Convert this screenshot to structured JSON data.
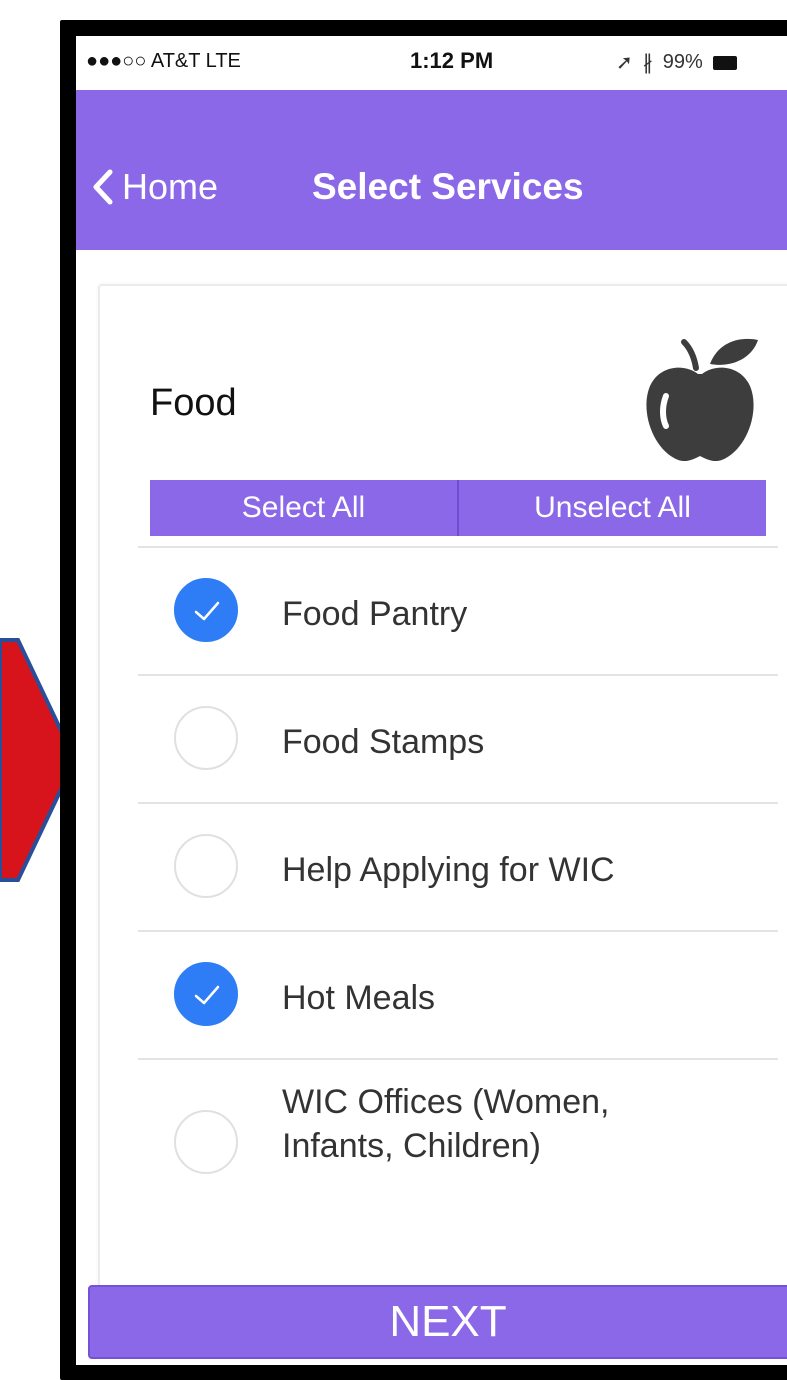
{
  "status_bar": {
    "carrier": "●●●○○ AT&T  LTE",
    "time": "1:12 PM",
    "battery": "99%"
  },
  "nav": {
    "back_label": "Home",
    "title": "Select Services"
  },
  "category": {
    "title": "Food",
    "icon": "apple-icon"
  },
  "buttons": {
    "select_all": "Select All",
    "unselect_all": "Unselect All",
    "next": "NEXT"
  },
  "services": [
    {
      "label": "Food Pantry",
      "checked": true
    },
    {
      "label": "Food Stamps",
      "checked": false
    },
    {
      "label": "Help Applying for WIC",
      "checked": false
    },
    {
      "label": "Hot Meals",
      "checked": true
    },
    {
      "label": "WIC Offices (Women, Infants, Children)",
      "checked": false
    }
  ],
  "colors": {
    "accent": "#8b68e8",
    "checked": "#2f7df6",
    "arrow": "#d7141c"
  }
}
